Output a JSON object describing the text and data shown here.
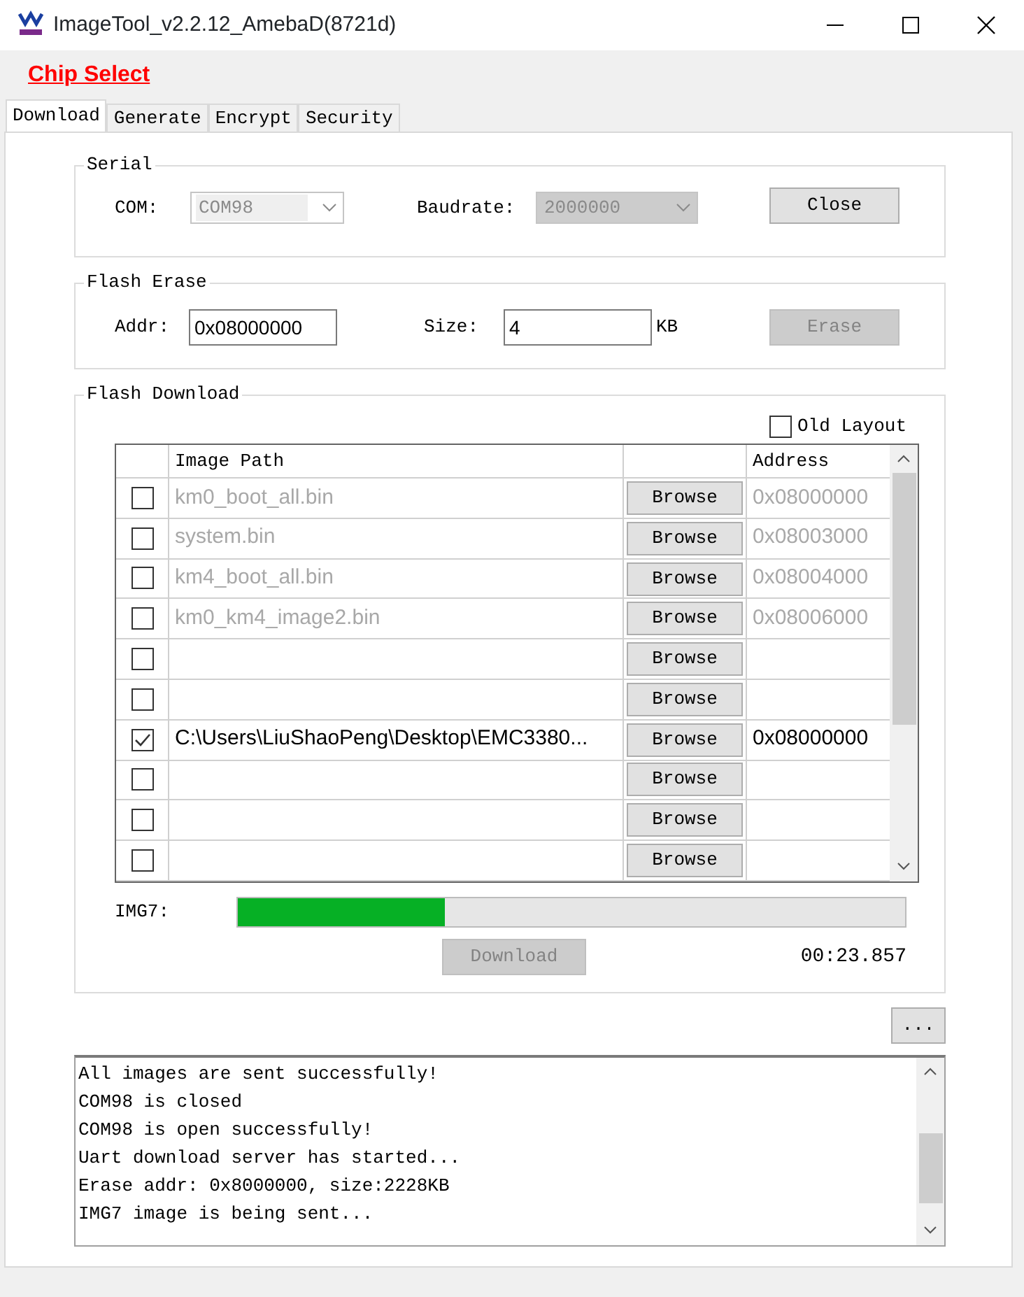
{
  "window": {
    "title": "ImageTool_v2.2.12_AmebaD(8721d)"
  },
  "menu": {
    "chip_select": "Chip Select"
  },
  "tabs": [
    {
      "label": "Download",
      "selected": true
    },
    {
      "label": "Generate",
      "selected": false
    },
    {
      "label": "Encrypt",
      "selected": false
    },
    {
      "label": "Security",
      "selected": false
    }
  ],
  "serial": {
    "title": "Serial",
    "com_label": "COM:",
    "com_value": "COM98",
    "com_disabled": true,
    "baudrate_label": "Baudrate:",
    "baudrate_value": "2000000",
    "baudrate_disabled": true,
    "button": "Close",
    "button_disabled": false
  },
  "flash_erase": {
    "title": "Flash Erase",
    "addr_label": "Addr:",
    "addr_value": "0x08000000",
    "size_label": "Size:",
    "size_value": "4",
    "size_unit": "KB",
    "button": "Erase",
    "button_disabled": true
  },
  "flash_download": {
    "title": "Flash Download",
    "old_layout": {
      "label": "Old Layout",
      "checked": false
    },
    "table": {
      "columns": [
        "Image Path",
        "Address"
      ],
      "rows": [
        {
          "checked": false,
          "path": "km0_boot_all.bin",
          "button": "Browse",
          "address": "0x08000000",
          "disabled": true
        },
        {
          "checked": false,
          "path": "system.bin",
          "button": "Browse",
          "address": "0x08003000",
          "disabled": true
        },
        {
          "checked": false,
          "path": "km4_boot_all.bin",
          "button": "Browse",
          "address": "0x08004000",
          "disabled": true
        },
        {
          "checked": false,
          "path": "km0_km4_image2.bin",
          "button": "Browse",
          "address": "0x08006000",
          "disabled": true
        },
        {
          "checked": false,
          "path": "",
          "button": "Browse",
          "address": ""
        },
        {
          "checked": false,
          "path": "",
          "button": "Browse",
          "address": ""
        },
        {
          "checked": true,
          "path": "C:\\Users\\LiuShaoPeng\\Desktop\\EMC3380...",
          "button": "Browse",
          "address": "0x08000000",
          "disabled": false
        },
        {
          "checked": false,
          "path": "",
          "button": "Browse",
          "address": ""
        },
        {
          "checked": false,
          "path": "",
          "button": "Browse",
          "address": ""
        },
        {
          "checked": false,
          "path": "",
          "button": "Browse",
          "address": ""
        }
      ]
    },
    "progress": {
      "label": "IMG7:",
      "level": 0.31
    },
    "button": "Download",
    "button_disabled": true,
    "elapsed": "00:23.857"
  },
  "more_button": "...",
  "log": [
    "All images are sent successfully!",
    "COM98 is closed",
    "COM98 is open successfully!",
    "Uart download server has started...",
    "Erase addr: 0x8000000, size:2228KB",
    "IMG7 image is being sent..."
  ]
}
